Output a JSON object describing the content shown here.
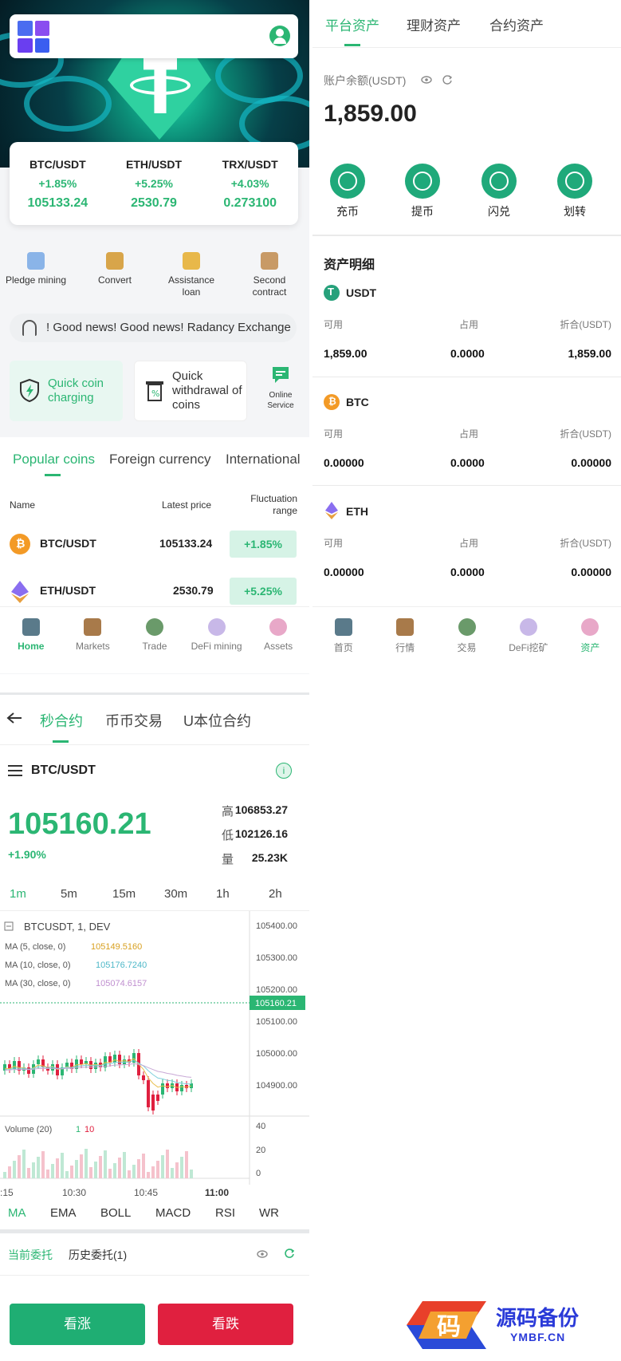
{
  "home": {
    "tickers": [
      {
        "pair": "BTC/USDT",
        "change": "+1.85%",
        "price": "105133.24"
      },
      {
        "pair": "ETH/USDT",
        "change": "+5.25%",
        "price": "2530.79"
      },
      {
        "pair": "TRX/USDT",
        "change": "+4.03%",
        "price": "0.273100"
      }
    ],
    "features": [
      {
        "label": "Pledge mining",
        "icon": "pledge-icon"
      },
      {
        "label": "Convert",
        "icon": "convert-icon"
      },
      {
        "label": "Assistance loan",
        "icon": "loan-icon"
      },
      {
        "label": "Second contract",
        "icon": "contract-icon"
      }
    ],
    "notice": "! Good news! Good news! Radancy Exchange",
    "quick_charge": "Quick coin charging",
    "quick_withdraw": "Quick withdrawal of coins",
    "online_service": "Online Service",
    "tabs": [
      "Popular coins",
      "Foreign currency",
      "International"
    ],
    "table_headers": {
      "name": "Name",
      "price": "Latest price",
      "range": "Fluctuation range"
    },
    "rows": [
      {
        "pair": "BTC/USDT",
        "price": "105133.24",
        "change": "+1.85%",
        "icon": "btc-icon"
      },
      {
        "pair": "ETH/USDT",
        "price": "2530.79",
        "change": "+5.25%",
        "icon": "eth-icon"
      }
    ],
    "nav": [
      "Home",
      "Markets",
      "Trade",
      "DeFi mining",
      "Assets"
    ]
  },
  "assets": {
    "tabs": [
      "平台资产",
      "理财资产",
      "合约资产"
    ],
    "balance_label": "账户余额(USDT)",
    "balance": "1,859.00",
    "actions": [
      "充币",
      "提币",
      "闪兑",
      "划转"
    ],
    "detail_title": "资产明细",
    "col_labels": {
      "available": "可用",
      "occupied": "占用",
      "converted": "折合(USDT)"
    },
    "coins": [
      {
        "name": "USDT",
        "available": "1,859.00",
        "occupied": "0.0000",
        "converted": "1,859.00"
      },
      {
        "name": "BTC",
        "available": "0.00000",
        "occupied": "0.0000",
        "converted": "0.00000"
      },
      {
        "name": "ETH",
        "available": "0.00000",
        "occupied": "0.0000",
        "converted": "0.00000"
      }
    ],
    "nav": [
      "首页",
      "行情",
      "交易",
      "DeFi挖矿",
      "资产"
    ]
  },
  "trade": {
    "tabs": [
      "秒合约",
      "币币交易",
      "U本位合约"
    ],
    "pair": "BTC/USDT",
    "price": "105160.21",
    "change": "+1.90%",
    "high_label": "高",
    "high": "106853.27",
    "low_label": "低",
    "low": "102126.16",
    "vol_label": "量",
    "vol": "25.23K",
    "timeframes": [
      "1m",
      "5m",
      "15m",
      "30m",
      "1h",
      "2h"
    ],
    "chart_title": "BTCUSDT, 1, DEV",
    "ma5": "MA (5, close, 0)",
    "ma5_val": "105149.5160",
    "ma10": "MA (10, close, 0)",
    "ma10_val": "105176.7240",
    "ma30": "MA (30, close, 0)",
    "ma30_val": "105074.6157",
    "price_axis": [
      "105400.00",
      "105300.00",
      "105200.00",
      "105100.00",
      "105000.00",
      "104900.00"
    ],
    "current_tag": "105160.21",
    "volume_label": "Volume (20)",
    "vol_a": "1",
    "vol_b": "10",
    "vol_axis": [
      "40",
      "20",
      "0"
    ],
    "time_axis": [
      ":15",
      "10:30",
      "10:45",
      "11:00"
    ],
    "indicators": [
      "MA",
      "EMA",
      "BOLL",
      "MACD",
      "RSI",
      "WR"
    ],
    "orders_current": "当前委托",
    "orders_history": "历史委托(1)",
    "buy": "看涨",
    "sell": "看跌"
  },
  "watermark": {
    "main": "源码备份",
    "sub": "YMBF.CN",
    "glyph": "码"
  },
  "colors": {
    "accent": "#2bb673",
    "sell": "#e0203f",
    "buy_btn": "#1fae73"
  }
}
